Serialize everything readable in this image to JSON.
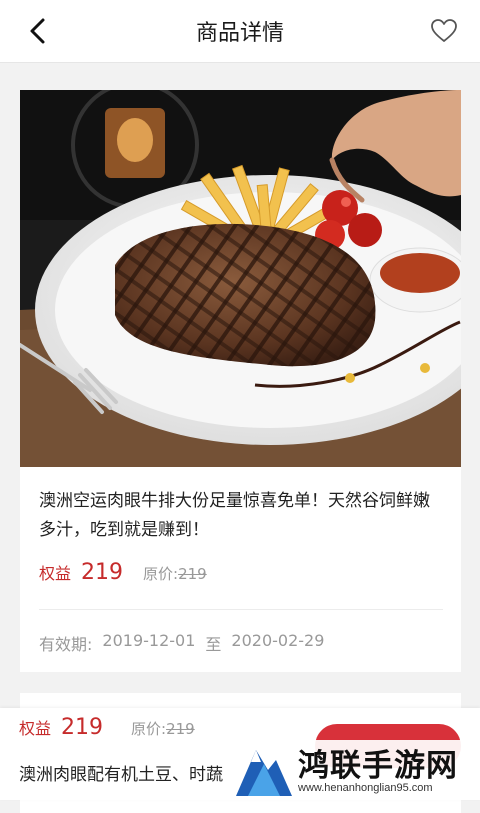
{
  "header": {
    "title": "商品详情"
  },
  "product": {
    "description": "澳洲空运肉眼牛排大份足量惊喜免单！天然谷饲鲜嫩多汁，吃到就是赚到！",
    "price_label": "权益",
    "price_value": "219",
    "original_label": "原价:",
    "original_value": "219",
    "validity_label": "有效期:",
    "validity_start": "2019-12-01",
    "validity_sep": "至",
    "validity_end": "2020-02-29"
  },
  "bottom_bar": {
    "price_label": "权益",
    "price_value": "219",
    "original_label": "原价:",
    "original_value": "219",
    "title": "澳洲肉眼配有机土豆、时蔬"
  },
  "watermark": {
    "text": "鸿联手游网",
    "url": "www.henanhonglian95.com"
  },
  "colors": {
    "accent": "#c62b2b",
    "button": "#d8313a"
  },
  "icons": {
    "back": "chevron-left-icon",
    "favorite": "heart-outline-icon",
    "logo": "mountain-logo-icon"
  }
}
